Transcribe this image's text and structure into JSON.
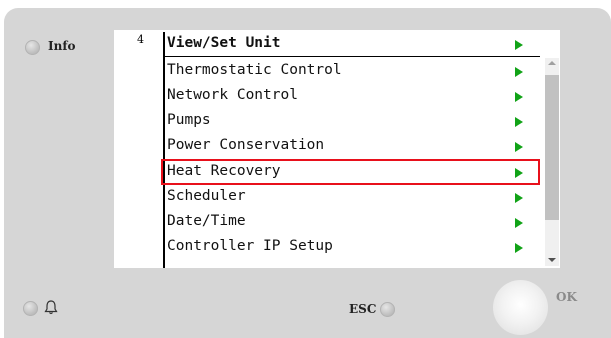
{
  "buttons": {
    "info_label": "Info",
    "esc_label": "ESC",
    "ok_label": "OK"
  },
  "screen": {
    "page_number": "4",
    "title": "View/Set Unit",
    "menu_items": [
      {
        "label": "Thermostatic Control"
      },
      {
        "label": "Network Control"
      },
      {
        "label": "Pumps"
      },
      {
        "label": "Power Conservation"
      },
      {
        "label": "Heat Recovery"
      },
      {
        "label": "Scheduler"
      },
      {
        "label": "Date/Time"
      },
      {
        "label": "Controller IP Setup"
      }
    ],
    "selected_item": "Heat Recovery"
  },
  "colors": {
    "arrow": "#11a317",
    "highlight": "#e8101b",
    "panel": "#d6d6d6"
  },
  "icons": {
    "arrow": "right-triangle-icon",
    "alarm": "bell-icon"
  }
}
